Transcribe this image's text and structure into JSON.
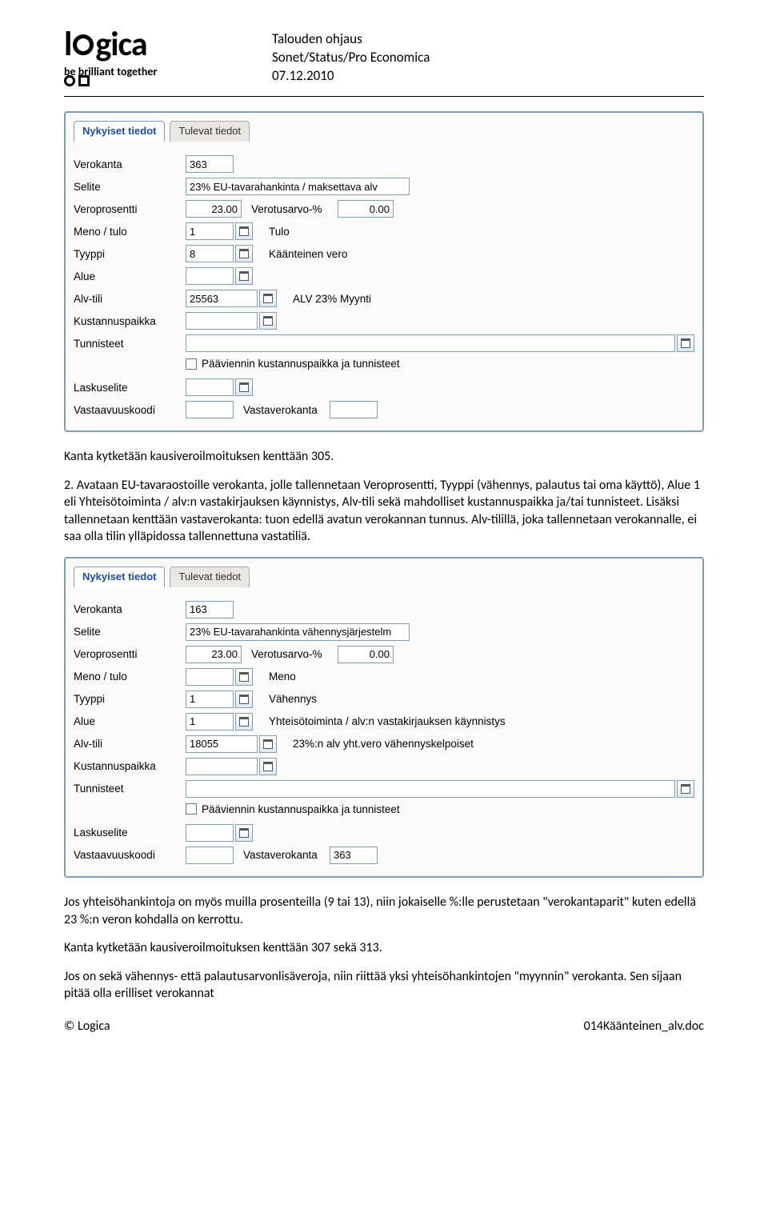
{
  "logo": {
    "brand": "logica",
    "tag": "be brilliant together"
  },
  "meta": {
    "l1": "Talouden ohjaus",
    "l2": "Sonet/Status/Pro Economica",
    "l3": "07.12.2010"
  },
  "tabs": {
    "active": "Nykyiset tiedot",
    "other": "Tulevat tiedot"
  },
  "labels": {
    "verokanta": "Verokanta",
    "selite": "Selite",
    "veroprosentti": "Veroprosentti",
    "verotusarvo": "Verotusarvo-%",
    "menotulo": "Meno / tulo",
    "tyyppi": "Tyyppi",
    "alue": "Alue",
    "alvtili": "Alv-tili",
    "kustannuspaikka": "Kustannuspaikka",
    "tunnisteet": "Tunnisteet",
    "paaviennin": "Pääviennin kustannuspaikka ja tunnisteet",
    "laskuselite": "Laskuselite",
    "vastaavuuskoodi": "Vastaavuuskoodi",
    "vastaverokanta": "Vastaverokanta"
  },
  "panel1": {
    "verokanta": "363",
    "selite": "23% EU-tavarahankinta / maksettava alv",
    "veroprosentti": "23.00",
    "verotusarvo": "0.00",
    "menotulo": "1",
    "menotulo_t": "Tulo",
    "tyyppi": "8",
    "tyyppi_t": "Käänteinen vero",
    "alue": "",
    "alvtili": "25563",
    "alvtili_t": "ALV 23% Myynti",
    "kustannuspaikka": "",
    "tunnisteet": "",
    "laskuselite": "",
    "vastaavuuskoodi": "",
    "vastaverokanta": ""
  },
  "para1": "Kanta kytketään kausiveroilmoituksen kenttään 305.",
  "para2": "2. Avataan EU-tavaraostoille verokanta, jolle tallennetaan Veroprosentti, Tyyppi (vähennys, palautus tai oma käyttö), Alue 1 eli Yhteisötoiminta / alv:n vastakirjauksen käynnistys, Alv-tili sekä mahdolliset kustannuspaikka ja/tai tunnisteet. Lisäksi tallennetaan kenttään vastaverokanta: tuon edellä avatun verokannan tunnus. Alv-tilillä, joka tallennetaan verokannalle, ei saa olla tilin ylläpidossa tallennettuna vastatiliä.",
  "panel2": {
    "verokanta": "163",
    "selite": "23% EU-tavarahankinta vähennysjärjestelm",
    "veroprosentti": "23.00",
    "verotusarvo": "0.00",
    "menotulo": "",
    "menotulo_t": "Meno",
    "tyyppi": "1",
    "tyyppi_t": "Vähennys",
    "alue": "1",
    "alue_t": "Yhteisötoiminta / alv:n vastakirjauksen käynnistys",
    "alvtili": "18055",
    "alvtili_t": "23%:n alv yht.vero vähennyskelpoiset",
    "kustannuspaikka": "",
    "tunnisteet": "",
    "laskuselite": "",
    "vastaavuuskoodi": "",
    "vastaverokanta": "363"
  },
  "para3": "Jos yhteisöhankintoja on myös muilla prosenteilla (9 tai 13), niin jokaiselle %:lle perustetaan \"verokantaparit\" kuten edellä 23 %:n veron kohdalla on kerrottu.",
  "para4": "Kanta kytketään kausiveroilmoituksen kenttään 307 sekä 313.",
  "para5": "Jos on sekä vähennys- että palautusarvonlisäveroja, niin riittää yksi yhteisöhankintojen \"myynnin\" verokanta. Sen sijaan pitää olla erilliset verokannat",
  "footer": {
    "left": "© Logica",
    "right": "014Käänteinen_alv.doc"
  }
}
